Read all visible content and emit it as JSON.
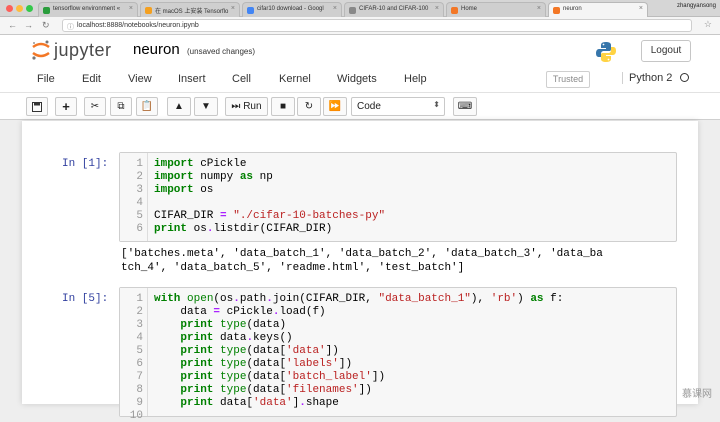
{
  "browser": {
    "tabs": [
      {
        "label": "tensorflow environment «",
        "fav": "#2a9d3c"
      },
      {
        "label": "在 macOS 上安装 Tensorflo",
        "fav": "#f4a020"
      },
      {
        "label": "cifar10 download - Googl",
        "fav": "#4285f4"
      },
      {
        "label": "CIFAR-10 and CIFAR-100",
        "fav": "#888888"
      },
      {
        "label": "Home",
        "fav": "#f37726"
      },
      {
        "label": "neuron",
        "fav": "#f37726"
      }
    ],
    "user": "zhangyansong",
    "url": "localhost:8888/notebooks/neuron.ipynb"
  },
  "header": {
    "brand": "jupyter",
    "notebook_name": "neuron",
    "save_status": "(unsaved changes)",
    "logout_label": "Logout"
  },
  "menubar": {
    "items": [
      "File",
      "Edit",
      "View",
      "Insert",
      "Cell",
      "Kernel",
      "Widgets",
      "Help"
    ],
    "trusted": "Trusted",
    "kernel": "Python 2"
  },
  "toolbar": {
    "run_label": "Run",
    "cell_type": "Code"
  },
  "cells": [
    {
      "prompt": "In [1]:",
      "line_numbers": [
        "1",
        "2",
        "3",
        "4",
        "5",
        "6"
      ],
      "output": "['batches.meta', 'data_batch_1', 'data_batch_2', 'data_batch_3', 'data_ba\ntch_4', 'data_batch_5', 'readme.html', 'test_batch']"
    },
    {
      "prompt": "In [5]:",
      "line_numbers": [
        "1",
        "2",
        "3",
        "4",
        "5",
        "6",
        "7",
        "8",
        "9",
        "10"
      ]
    }
  ],
  "watermark": "慕课网"
}
